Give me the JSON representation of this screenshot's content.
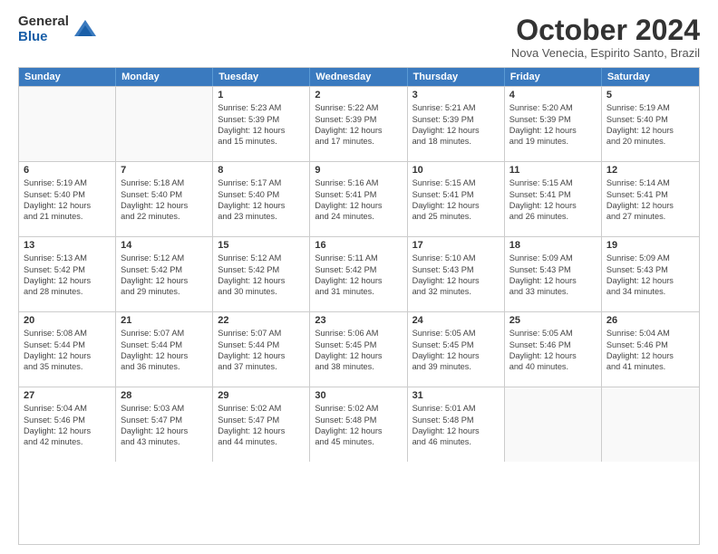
{
  "logo": {
    "general": "General",
    "blue": "Blue"
  },
  "header": {
    "month": "October 2024",
    "location": "Nova Venecia, Espirito Santo, Brazil"
  },
  "days": [
    "Sunday",
    "Monday",
    "Tuesday",
    "Wednesday",
    "Thursday",
    "Friday",
    "Saturday"
  ],
  "rows": [
    [
      {
        "day": "",
        "lines": []
      },
      {
        "day": "",
        "lines": []
      },
      {
        "day": "1",
        "lines": [
          "Sunrise: 5:23 AM",
          "Sunset: 5:39 PM",
          "Daylight: 12 hours",
          "and 15 minutes."
        ]
      },
      {
        "day": "2",
        "lines": [
          "Sunrise: 5:22 AM",
          "Sunset: 5:39 PM",
          "Daylight: 12 hours",
          "and 17 minutes."
        ]
      },
      {
        "day": "3",
        "lines": [
          "Sunrise: 5:21 AM",
          "Sunset: 5:39 PM",
          "Daylight: 12 hours",
          "and 18 minutes."
        ]
      },
      {
        "day": "4",
        "lines": [
          "Sunrise: 5:20 AM",
          "Sunset: 5:39 PM",
          "Daylight: 12 hours",
          "and 19 minutes."
        ]
      },
      {
        "day": "5",
        "lines": [
          "Sunrise: 5:19 AM",
          "Sunset: 5:40 PM",
          "Daylight: 12 hours",
          "and 20 minutes."
        ]
      }
    ],
    [
      {
        "day": "6",
        "lines": [
          "Sunrise: 5:19 AM",
          "Sunset: 5:40 PM",
          "Daylight: 12 hours",
          "and 21 minutes."
        ]
      },
      {
        "day": "7",
        "lines": [
          "Sunrise: 5:18 AM",
          "Sunset: 5:40 PM",
          "Daylight: 12 hours",
          "and 22 minutes."
        ]
      },
      {
        "day": "8",
        "lines": [
          "Sunrise: 5:17 AM",
          "Sunset: 5:40 PM",
          "Daylight: 12 hours",
          "and 23 minutes."
        ]
      },
      {
        "day": "9",
        "lines": [
          "Sunrise: 5:16 AM",
          "Sunset: 5:41 PM",
          "Daylight: 12 hours",
          "and 24 minutes."
        ]
      },
      {
        "day": "10",
        "lines": [
          "Sunrise: 5:15 AM",
          "Sunset: 5:41 PM",
          "Daylight: 12 hours",
          "and 25 minutes."
        ]
      },
      {
        "day": "11",
        "lines": [
          "Sunrise: 5:15 AM",
          "Sunset: 5:41 PM",
          "Daylight: 12 hours",
          "and 26 minutes."
        ]
      },
      {
        "day": "12",
        "lines": [
          "Sunrise: 5:14 AM",
          "Sunset: 5:41 PM",
          "Daylight: 12 hours",
          "and 27 minutes."
        ]
      }
    ],
    [
      {
        "day": "13",
        "lines": [
          "Sunrise: 5:13 AM",
          "Sunset: 5:42 PM",
          "Daylight: 12 hours",
          "and 28 minutes."
        ]
      },
      {
        "day": "14",
        "lines": [
          "Sunrise: 5:12 AM",
          "Sunset: 5:42 PM",
          "Daylight: 12 hours",
          "and 29 minutes."
        ]
      },
      {
        "day": "15",
        "lines": [
          "Sunrise: 5:12 AM",
          "Sunset: 5:42 PM",
          "Daylight: 12 hours",
          "and 30 minutes."
        ]
      },
      {
        "day": "16",
        "lines": [
          "Sunrise: 5:11 AM",
          "Sunset: 5:42 PM",
          "Daylight: 12 hours",
          "and 31 minutes."
        ]
      },
      {
        "day": "17",
        "lines": [
          "Sunrise: 5:10 AM",
          "Sunset: 5:43 PM",
          "Daylight: 12 hours",
          "and 32 minutes."
        ]
      },
      {
        "day": "18",
        "lines": [
          "Sunrise: 5:09 AM",
          "Sunset: 5:43 PM",
          "Daylight: 12 hours",
          "and 33 minutes."
        ]
      },
      {
        "day": "19",
        "lines": [
          "Sunrise: 5:09 AM",
          "Sunset: 5:43 PM",
          "Daylight: 12 hours",
          "and 34 minutes."
        ]
      }
    ],
    [
      {
        "day": "20",
        "lines": [
          "Sunrise: 5:08 AM",
          "Sunset: 5:44 PM",
          "Daylight: 12 hours",
          "and 35 minutes."
        ]
      },
      {
        "day": "21",
        "lines": [
          "Sunrise: 5:07 AM",
          "Sunset: 5:44 PM",
          "Daylight: 12 hours",
          "and 36 minutes."
        ]
      },
      {
        "day": "22",
        "lines": [
          "Sunrise: 5:07 AM",
          "Sunset: 5:44 PM",
          "Daylight: 12 hours",
          "and 37 minutes."
        ]
      },
      {
        "day": "23",
        "lines": [
          "Sunrise: 5:06 AM",
          "Sunset: 5:45 PM",
          "Daylight: 12 hours",
          "and 38 minutes."
        ]
      },
      {
        "day": "24",
        "lines": [
          "Sunrise: 5:05 AM",
          "Sunset: 5:45 PM",
          "Daylight: 12 hours",
          "and 39 minutes."
        ]
      },
      {
        "day": "25",
        "lines": [
          "Sunrise: 5:05 AM",
          "Sunset: 5:46 PM",
          "Daylight: 12 hours",
          "and 40 minutes."
        ]
      },
      {
        "day": "26",
        "lines": [
          "Sunrise: 5:04 AM",
          "Sunset: 5:46 PM",
          "Daylight: 12 hours",
          "and 41 minutes."
        ]
      }
    ],
    [
      {
        "day": "27",
        "lines": [
          "Sunrise: 5:04 AM",
          "Sunset: 5:46 PM",
          "Daylight: 12 hours",
          "and 42 minutes."
        ]
      },
      {
        "day": "28",
        "lines": [
          "Sunrise: 5:03 AM",
          "Sunset: 5:47 PM",
          "Daylight: 12 hours",
          "and 43 minutes."
        ]
      },
      {
        "day": "29",
        "lines": [
          "Sunrise: 5:02 AM",
          "Sunset: 5:47 PM",
          "Daylight: 12 hours",
          "and 44 minutes."
        ]
      },
      {
        "day": "30",
        "lines": [
          "Sunrise: 5:02 AM",
          "Sunset: 5:48 PM",
          "Daylight: 12 hours",
          "and 45 minutes."
        ]
      },
      {
        "day": "31",
        "lines": [
          "Sunrise: 5:01 AM",
          "Sunset: 5:48 PM",
          "Daylight: 12 hours",
          "and 46 minutes."
        ]
      },
      {
        "day": "",
        "lines": []
      },
      {
        "day": "",
        "lines": []
      }
    ]
  ]
}
